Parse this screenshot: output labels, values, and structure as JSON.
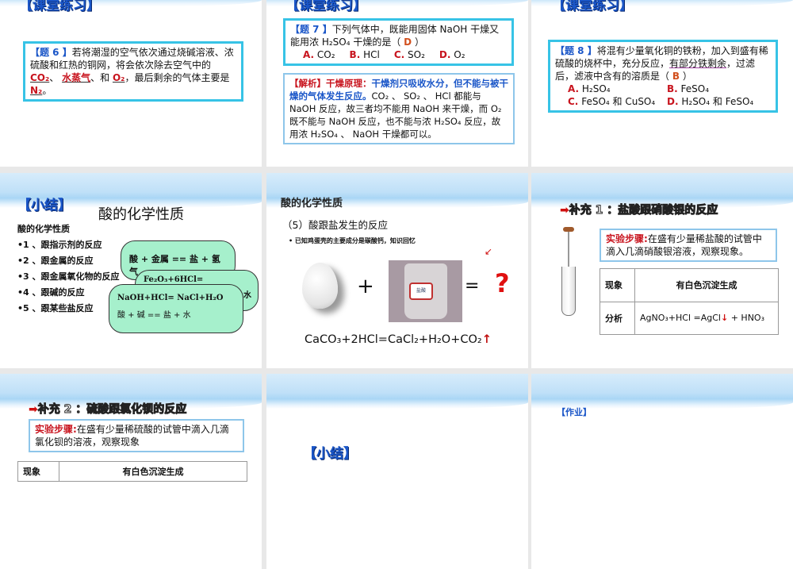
{
  "slides": [
    {
      "heading": "【课堂练习】",
      "q_label": "【题 6 】",
      "q_text": "若将潮湿的空气依次通过烧碱溶液、浓硫酸和红热的铜网，将会依次除去空气中的",
      "a1": "CO₂",
      "sep1": "、",
      "a2": "水蒸气",
      "sep2": "、和",
      "a3": "O₂",
      "tail": "，最后剩余的气体主要是",
      "a4": "N₂",
      "end": "。"
    },
    {
      "heading": "【课堂练习】",
      "q_label": "【题 7 】",
      "q_text": "下列气体中，既能用固体 NaOH 干燥又能用浓 H₂SO₄ 干燥的是（",
      "answer": "D",
      "q_close": "）",
      "options": [
        {
          "k": "A.",
          "v": "CO₂"
        },
        {
          "k": "B.",
          "v": "HCl"
        },
        {
          "k": "C.",
          "v": "SO₂"
        },
        {
          "k": "D.",
          "v": "O₂"
        }
      ],
      "expl_label": "【解析】干燥原理：",
      "expl_blue": "干燥剂只吸收水分，但不能与被干燥的气体发生反应。",
      "expl_text": "CO₂ 、 SO₂ 、 HCl 都能与 NaOH 反应，故三者均不能用 NaOH 来干燥，而 O₂ 既不能与 NaOH 反应，也不能与浓 H₂SO₄ 反应，故用浓 H₂SO₄ 、 NaOH 干燥都可以。"
    },
    {
      "heading": "【课堂练习】",
      "q_label": "【题 8 】",
      "q_text1": "将混有少量氧化铜的铁粉，加入到盛有稀硫酸的烧杯中，充分反应，",
      "q_under": "有部分铁剩余",
      "q_text2": "，过滤后，滤液中含有的溶质是（",
      "answer": "B",
      "q_close": "）",
      "options": [
        {
          "k": "A.",
          "v": "H₂SO₄"
        },
        {
          "k": "B.",
          "v": "FeSO₄"
        },
        {
          "k": "C.",
          "v": "FeSO₄ 和 CuSO₄"
        },
        {
          "k": "D.",
          "v": "H₂SO₄ 和 FeSO₄"
        }
      ]
    },
    {
      "heading": "【小结】",
      "title": "酸的化学性质",
      "subtitle": "酸的化学性质",
      "items": [
        "•1 、跟指示剂的反应",
        "•2 、跟金属的反应",
        "•3 、跟金属氧化物的反应",
        "•4 、跟碱的反应",
        "•5 、跟某些盐反应"
      ],
      "bubble1": "酸 + 金属 == 盐 + 氢气",
      "bubble2": "Fe₂O₃+6HCl= 2FeCl₃+3H₂O",
      "bubble2_tail": "水",
      "bubble3a": "NaOH+HCl= NaCl+H₂O",
      "bubble3b": "酸 + 碱 == 盐 + 水"
    },
    {
      "heading": "酸的化学性质",
      "sub": "（5）酸跟盐发生的反应",
      "bullet": "已知鸡蛋壳的主要成分是碳酸钙，知识回忆",
      "plus": "+",
      "eq": "=",
      "q": "?",
      "bottle_label": "盐酸",
      "equation": "CaCO₃+2HCl=CaCl₂+H₂O+CO₂",
      "arrow": "↑"
    },
    {
      "heading": "补充 1 ：盐酸跟硝酸银的反应",
      "step_label": "实验步骤:",
      "step_text": "在盛有少量稀盐酸的试管中滴入几滴硝酸银溶液，观察现象。",
      "r1k": "现象",
      "r1v": "有白色沉淀生成",
      "r2k": "分析",
      "r2v": "AgNO₃+HCl =AgCl",
      "r2arrow": "↓",
      "r2tail": " + HNO₃"
    },
    {
      "heading": "补充 2 ：硫酸跟氯化钡的反应",
      "step_label": "实验步骤:",
      "step_text": "在盛有少量稀硫酸的试管中滴入几滴氯化钡的溶液，观察现象",
      "r1k": "现象",
      "r1v": "有白色沉淀生成"
    },
    {
      "heading": "【小结】"
    },
    {
      "heading": "【作业】"
    }
  ]
}
